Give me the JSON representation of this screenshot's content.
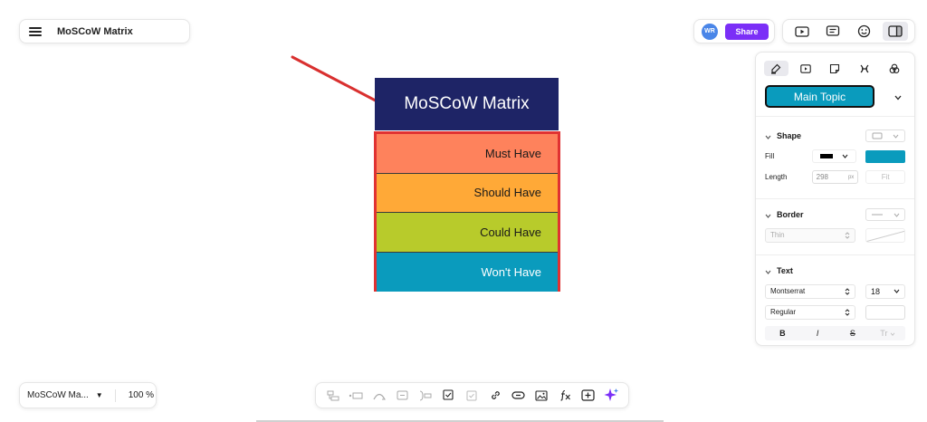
{
  "app": {
    "title": "MoSCoW Matrix",
    "share_label": "Share",
    "avatar_initials": "WR"
  },
  "mindmap": {
    "topic": "MoSCoW Matrix",
    "subtopics": [
      {
        "label": "Must Have",
        "color": "#fe825c"
      },
      {
        "label": "Should Have",
        "color": "#ffa937"
      },
      {
        "label": "Could Have",
        "color": "#b8cb2b"
      },
      {
        "label": "Won't Have",
        "color": "#0a9bbd"
      }
    ],
    "topic_color": "#1e2466",
    "selection_color": "#e03232"
  },
  "panel": {
    "style_name": "Main Topic",
    "shape": {
      "section_label": "Shape",
      "fill_label": "Fill",
      "fill_color": "#0a9bbd",
      "length_label": "Length",
      "length_value": "298",
      "length_unit": "px",
      "fit_label": "Fit"
    },
    "border": {
      "section_label": "Border",
      "weight": "Thin"
    },
    "text": {
      "section_label": "Text",
      "font": "Montserrat",
      "size": "18",
      "weight": "Regular",
      "bold": "B",
      "italic": "I",
      "strike": "S",
      "case": "Tr"
    }
  },
  "bottom_left": {
    "map_name": "MoSCoW Ma...",
    "zoom": "100 %"
  },
  "accent_color": "#7b2ff7"
}
